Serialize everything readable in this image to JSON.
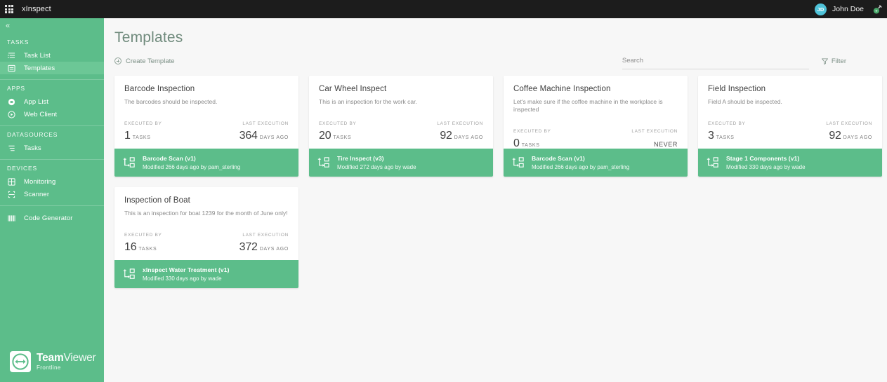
{
  "topbar": {
    "grid_icon": "app-grid-icon",
    "brand": "xInspect",
    "user": {
      "initials": "JD",
      "name": "John Doe"
    },
    "status_icon": "connection-status-icon"
  },
  "sidebar": {
    "collapse_icon": "chevron-left-icon",
    "sections": [
      {
        "label": "TASKS",
        "items": [
          {
            "label": "Task List",
            "icon": "list-icon",
            "active": false
          },
          {
            "label": "Templates",
            "icon": "template-icon",
            "active": true
          }
        ]
      },
      {
        "label": "APPS",
        "items": [
          {
            "label": "App List",
            "icon": "apps-icon",
            "active": false
          },
          {
            "label": "Web Client",
            "icon": "play-circle-icon",
            "active": false
          }
        ]
      },
      {
        "label": "DATASOURCES",
        "items": [
          {
            "label": "Tasks",
            "icon": "datasource-icon",
            "active": false
          }
        ]
      },
      {
        "label": "DEVICES",
        "items": [
          {
            "label": "Monitoring",
            "icon": "monitoring-icon",
            "active": false
          },
          {
            "label": "Scanner",
            "icon": "scanner-icon",
            "active": false
          }
        ]
      },
      {
        "label": "",
        "items": [
          {
            "label": "Code Generator",
            "icon": "code-generator-icon",
            "active": false
          }
        ]
      }
    ],
    "logo": {
      "brand_bold": "Team",
      "brand_light": "Viewer",
      "sub": "Frontline"
    }
  },
  "main": {
    "page_title": "Templates",
    "create_label": "Create Template",
    "search_placeholder": "Search",
    "search_value": "",
    "filter_label": "Filter",
    "stat_labels": {
      "executed_by": "EXECUTED BY",
      "last_execution": "LAST EXECUTION"
    },
    "cards": [
      {
        "title": "Barcode Inspection",
        "description": "The barcodes should be inspected.",
        "tasks_count": "1",
        "tasks_unit": "TASKS",
        "last_execution_value": "364",
        "last_execution_unit": "DAYS AGO",
        "workflow_name": "Barcode Scan (v1)",
        "workflow_meta": "Modified 266 days ago by pam_sterling"
      },
      {
        "title": "Car Wheel Inspect",
        "description": "This is an inspection for the work car.",
        "tasks_count": "20",
        "tasks_unit": "TASKS",
        "last_execution_value": "92",
        "last_execution_unit": "DAYS AGO",
        "workflow_name": "Tire Inspect (v3)",
        "workflow_meta": "Modified 272 days ago by wade"
      },
      {
        "title": "Coffee Machine Inspection",
        "description": "Let's make sure if the coffee machine in the workplace is inspected",
        "tasks_count": "0",
        "tasks_unit": "TASKS",
        "last_execution_value": "",
        "last_execution_unit": "NEVER",
        "workflow_name": "Barcode Scan (v1)",
        "workflow_meta": "Modified 266 days ago by pam_sterling"
      },
      {
        "title": "Field Inspection",
        "description": "Field A should be inspected.",
        "tasks_count": "3",
        "tasks_unit": "TASKS",
        "last_execution_value": "92",
        "last_execution_unit": "DAYS AGO",
        "workflow_name": "Stage 1 Components (v1)",
        "workflow_meta": "Modified 330 days ago by wade"
      },
      {
        "title": "Inspection of Boat",
        "description": "This is an inspection for boat 1239 for the month of June only!",
        "tasks_count": "16",
        "tasks_unit": "TASKS",
        "last_execution_value": "372",
        "last_execution_unit": "DAYS AGO",
        "workflow_name": "xInspect Water Treatment (v1)",
        "workflow_meta": "Modified 330 days ago by wade"
      }
    ]
  },
  "colors": {
    "brand_green": "#5cbd8a",
    "brand_green_active": "#6cc796",
    "topbar": "#1c1c1c",
    "avatar": "#4fc3d9",
    "page_bg": "#f7f7f7",
    "title_text": "#6f8a7c"
  }
}
